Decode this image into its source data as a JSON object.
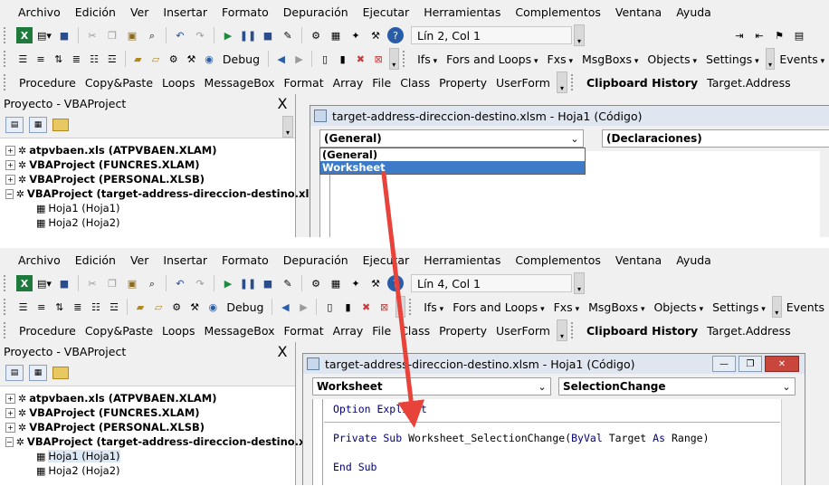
{
  "menu": [
    "Archivo",
    "Edición",
    "Ver",
    "Insertar",
    "Formato",
    "Depuración",
    "Ejecutar",
    "Herramientas",
    "Complementos",
    "Ventana",
    "Ayuda"
  ],
  "toolbar2": {
    "debug_label": "Debug"
  },
  "toolbar3_menus": [
    "Ifs",
    "Fors and Loops",
    "Fxs",
    "MsgBoxs",
    "Objects",
    "Settings",
    "Events"
  ],
  "toolbar4": [
    "Procedure",
    "Copy&Paste",
    "Loops",
    "MessageBox",
    "Format",
    "Array",
    "File",
    "Class",
    "Property",
    "UserForm"
  ],
  "toolbar4_bold": "Clipboard History",
  "toolbar4_last": "Target.Address",
  "project": {
    "title": "Proyecto - VBAProject",
    "close": "X",
    "items": [
      {
        "label": "atpvbaen.xls (ATPVBAEN.XLAM)",
        "expander": "+"
      },
      {
        "label": "VBAProject (FUNCRES.XLAM)",
        "expander": "+"
      },
      {
        "label": "VBAProject (PERSONAL.XLSB)",
        "expander": "+"
      },
      {
        "label": "VBAProject (target-address-direccion-destino.xls",
        "expander": "−"
      }
    ],
    "children": [
      "Hoja1 (Hoja1)",
      "Hoja2 (Hoja2)"
    ]
  },
  "before": {
    "position": "Lín 2, Col 1",
    "window_title": "target-address-direccion-destino.xlsm - Hoja1 (Código)",
    "object_combo": "(General)",
    "procedure_combo": "(Declaraciones)",
    "dropdown": [
      "(General)",
      "Worksheet"
    ]
  },
  "after": {
    "position": "Lín 4, Col 1",
    "window_title": "target-address-direccion-destino.xlsm - Hoja1 (Código)",
    "object_combo": "Worksheet",
    "procedure_combo": "SelectionChange",
    "code": {
      "line1": "Option Explicit",
      "line2_kw": "Private Sub",
      "line2_name": "Worksheet_SelectionChange(",
      "line2_kw2": "ByVal",
      "line2_target": "Target",
      "line2_as": "As",
      "line2_type": "Range)",
      "line3": "End Sub"
    }
  },
  "colors": {
    "arrow": "#e8433a",
    "selection": "#3d7bc8",
    "keyword": "#00007f"
  }
}
